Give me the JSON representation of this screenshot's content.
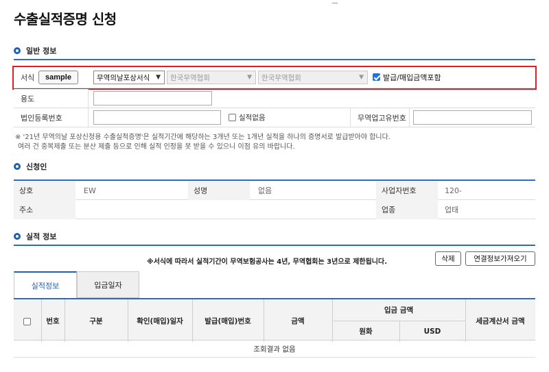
{
  "page": {
    "title": "수출실적증명 신청"
  },
  "general": {
    "section_title": "일반 정보",
    "form_label": "서식",
    "sample_label": "sample",
    "form_select": "무역의날포상서식",
    "org_select_1": "한국무역협회",
    "org_select_2": "한국무역협회",
    "include_amount_label": "발급/매입금액포함",
    "include_amount_checked": true,
    "purpose_label": "용도",
    "corp_reg_label": "법인등록번호",
    "no_record_label": "실적없음",
    "no_record_checked": false,
    "trade_id_label": "무역업고유번호",
    "notes": [
      "※ '21년 무역의날 포상신청용 수출실적증명'은 실적기간에 해당하는 3개년 또는 1개년 실적을 하나의 증명서로 발급받아야 합니다.",
      "여러 건 중복제출 또는 분산 제출 등으로 인해 실적 인정을 못 받을 수 있으니 이점 유의 바랍니다."
    ]
  },
  "applicant": {
    "section_title": "신청인",
    "company_label": "상호",
    "company_value": "EW",
    "name_label": "성명",
    "name_value": "없음",
    "biz_no_label": "사업자번호",
    "biz_no_value": "120-",
    "address_label": "주소",
    "industry_label": "업종",
    "industry_value": "업태"
  },
  "performance": {
    "section_title": "실적 정보",
    "notice": "※서식에 따라서 실적기간이 무역보험공사는 4년, 무역협회는 3년으로 제한됩니다.",
    "delete_label": "삭제",
    "fetch_label": "연결정보가져오기",
    "tabs": [
      "실적정보",
      "입금일자"
    ],
    "columns": {
      "no": "번호",
      "type": "구분",
      "confirm_date": "확인(매입)일자",
      "issue_no": "발급(매입)번호",
      "amount": "금액",
      "deposit_amount": "입금 금액",
      "krw": "원화",
      "usd": "USD",
      "tax_invoice": "세금계산서 금액"
    },
    "empty_text": "조회결과 없음"
  },
  "colors": {
    "accent": "#1f5fb0",
    "highlight": "#e02020"
  }
}
